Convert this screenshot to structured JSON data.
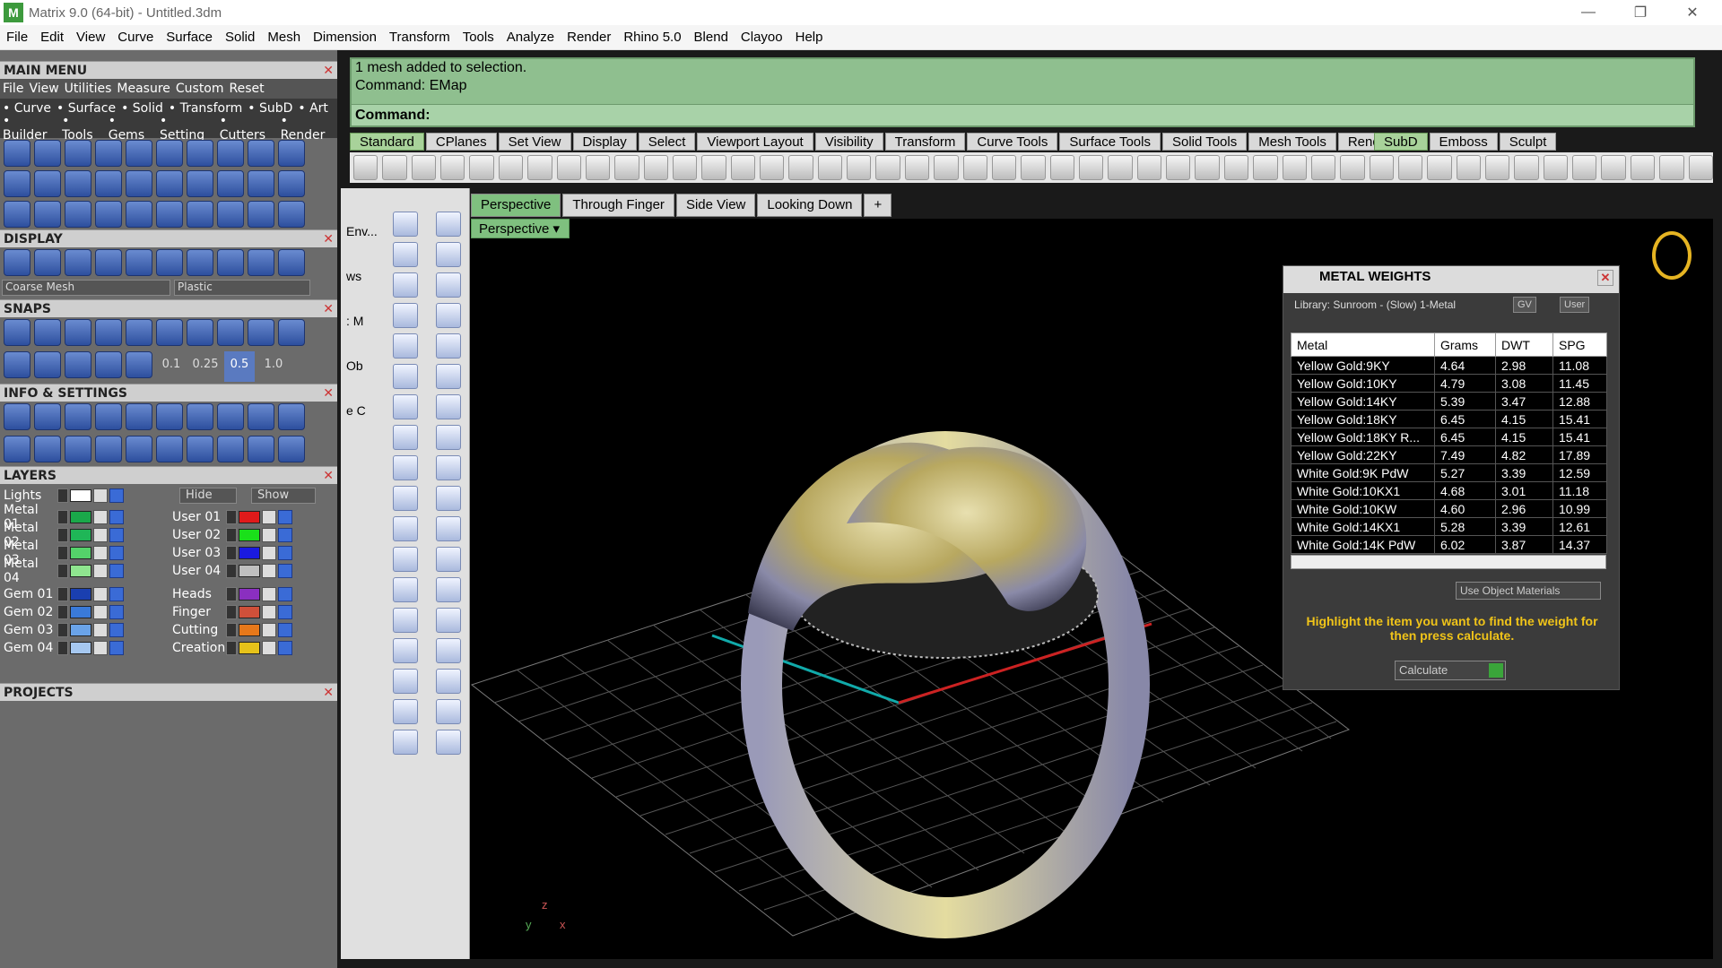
{
  "window": {
    "title": "Matrix 9.0 (64-bit) - Untitled.3dm",
    "logo": "M"
  },
  "menubar": [
    "File",
    "Edit",
    "View",
    "Curve",
    "Surface",
    "Solid",
    "Mesh",
    "Dimension",
    "Transform",
    "Tools",
    "Analyze",
    "Render",
    "Rhino 5.0",
    "Blend",
    "Clayoo",
    "Help"
  ],
  "left": {
    "main_menu": "MAIN MENU",
    "main_sub": [
      "File",
      "View",
      "Utilities",
      "Measure",
      "Custom",
      "Reset"
    ],
    "cat_row1": [
      "Curve",
      "Surface",
      "Solid",
      "Transform",
      "SubD",
      "Art"
    ],
    "cat_row2": [
      "Builder",
      "Tools",
      "Gems",
      "Setting",
      "Cutters",
      "Render"
    ],
    "display": "DISPLAY",
    "display_mesh": "Coarse Mesh",
    "display_mat": "Plastic",
    "snaps": "SNAPS",
    "snap_vals": [
      "0.1",
      "0.25",
      "0.5",
      "1.0"
    ],
    "info": "INFO & SETTINGS",
    "layers": "LAYERS",
    "lights": "Lights",
    "hide": "Hide",
    "show": "Show",
    "layers_left": [
      {
        "name": "Metal 01",
        "color": "#1aa84a"
      },
      {
        "name": "Metal 02",
        "color": "#1fb657"
      },
      {
        "name": "Metal 03",
        "color": "#54d36a"
      },
      {
        "name": "Metal 04",
        "color": "#8fe58f"
      },
      {
        "name": "Gem 01",
        "color": "#1a3fb0"
      },
      {
        "name": "Gem 02",
        "color": "#3a7ad8"
      },
      {
        "name": "Gem 03",
        "color": "#6aa3e8"
      },
      {
        "name": "Gem 04",
        "color": "#a6c8f0"
      }
    ],
    "layers_right": [
      {
        "name": "User 01",
        "color": "#e01a1a"
      },
      {
        "name": "User 02",
        "color": "#1ae01a"
      },
      {
        "name": "User 03",
        "color": "#1a1ae0"
      },
      {
        "name": "User 04",
        "color": "#bfbfbf"
      },
      {
        "name": "Heads",
        "color": "#8a2fc0"
      },
      {
        "name": "Finger",
        "color": "#d0503a"
      },
      {
        "name": "Cutting",
        "color": "#e6781a"
      },
      {
        "name": "Creation",
        "color": "#e6c21a"
      }
    ],
    "projects": "PROJECTS"
  },
  "command": {
    "line1": "1 mesh added to selection.",
    "line2": "Command: EMap",
    "prompt": "Command:"
  },
  "toolbar_tabs": [
    "Standard",
    "CPlanes",
    "Set View",
    "Display",
    "Select",
    "Viewport Layout",
    "Visibility",
    "Transform",
    "Curve Tools",
    "Surface Tools",
    "Solid Tools",
    "Mesh Tools",
    "Render To"
  ],
  "toolbar_tabs2": [
    "SubD",
    "Emboss",
    "Sculpt"
  ],
  "side_labels": [
    "Env...",
    "ws",
    ": M",
    "Ob",
    "e C"
  ],
  "viewport_tabs": [
    "Perspective",
    "Through Finger",
    "Side View",
    "Looking Down"
  ],
  "viewport_name": "Perspective",
  "axes": {
    "z": "z",
    "x": "x",
    "y": "y"
  },
  "metal_weights": {
    "title": "METAL WEIGHTS",
    "library": "Library: Sunroom - (Slow) 1-Metal",
    "gv": "GV",
    "user": "User",
    "columns": [
      "Metal",
      "Grams",
      "DWT",
      "SPG"
    ],
    "rows": [
      [
        "Yellow Gold:9KY",
        "4.64",
        "2.98",
        "11.08"
      ],
      [
        "Yellow Gold:10KY",
        "4.79",
        "3.08",
        "11.45"
      ],
      [
        "Yellow Gold:14KY",
        "5.39",
        "3.47",
        "12.88"
      ],
      [
        "Yellow Gold:18KY",
        "6.45",
        "4.15",
        "15.41"
      ],
      [
        "Yellow Gold:18KY R...",
        "6.45",
        "4.15",
        "15.41"
      ],
      [
        "Yellow Gold:22KY",
        "7.49",
        "4.82",
        "17.89"
      ],
      [
        "White Gold:9K PdW",
        "5.27",
        "3.39",
        "12.59"
      ],
      [
        "White Gold:10KX1",
        "4.68",
        "3.01",
        "11.18"
      ],
      [
        "White Gold:10KW",
        "4.60",
        "2.96",
        "10.99"
      ],
      [
        "White Gold:14KX1",
        "5.28",
        "3.39",
        "12.61"
      ],
      [
        "White Gold:14K PdW",
        "6.02",
        "3.87",
        "14.37"
      ]
    ],
    "use_object": "Use Object Materials",
    "message": "Highlight the item you want to find the weight for then press calculate.",
    "calculate": "Calculate"
  }
}
